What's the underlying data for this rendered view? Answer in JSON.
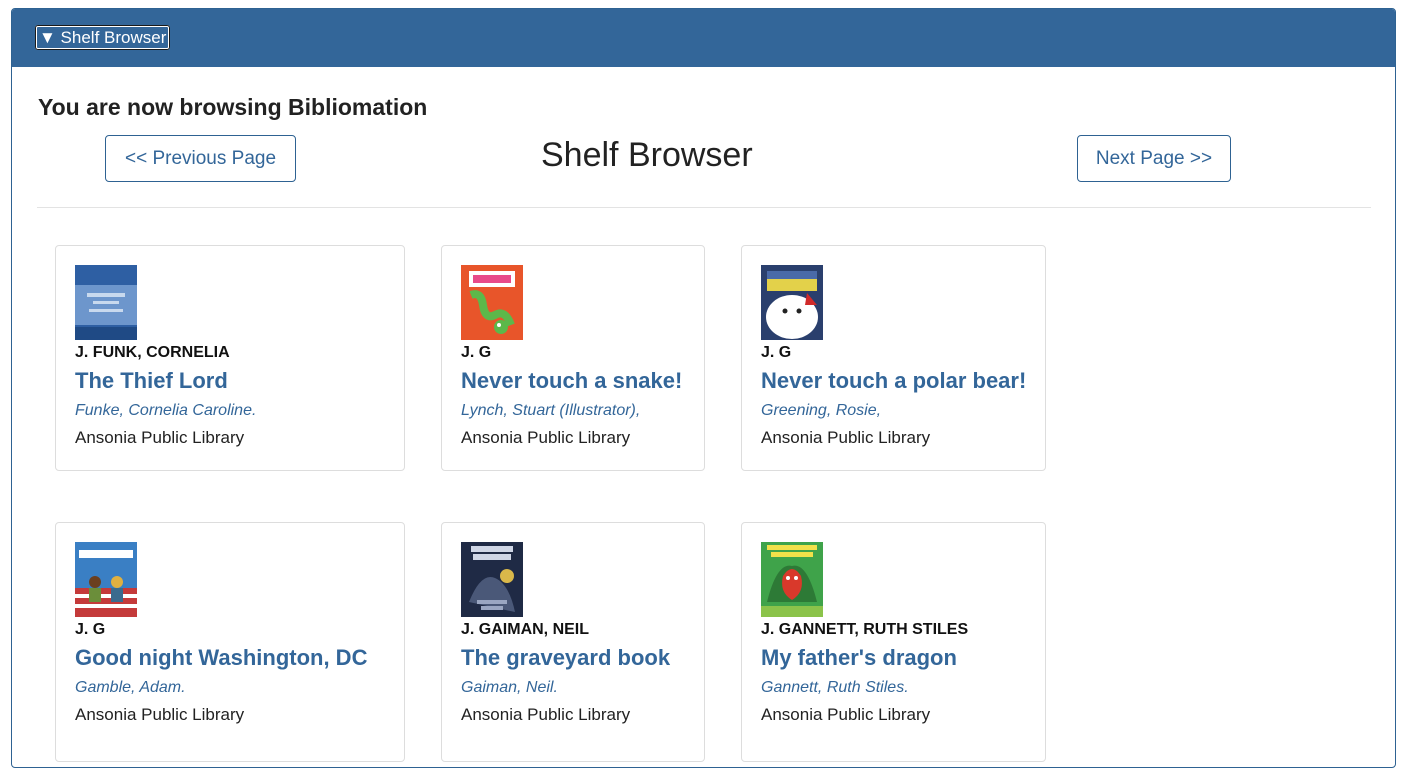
{
  "panel": {
    "toggle_label": "▼ Shelf Browser"
  },
  "header": {
    "browsing_text": "You are now browsing Bibliomation",
    "title": "Shelf Browser",
    "prev_label": "<< Previous Page",
    "next_label": "Next Page >>"
  },
  "books": [
    {
      "call_number": "J. FUNK, CORNELIA",
      "title": "The Thief Lord",
      "author": "Funke, Cornelia Caroline.",
      "library": "Ansonia Public Library",
      "cover_colors": [
        "#3d6fb0",
        "#9dbbe0"
      ]
    },
    {
      "call_number": "J. G",
      "title": "Never touch a snake!",
      "author": "Lynch, Stuart (Illustrator),",
      "library": "Ansonia Public Library",
      "cover_colors": [
        "#e8552a",
        "#5cb84a"
      ]
    },
    {
      "call_number": "J. G",
      "title": "Never touch a polar bear!",
      "author": "Greening, Rosie,",
      "library": "Ansonia Public Library",
      "cover_colors": [
        "#2a3f6d",
        "#ffffff"
      ]
    },
    {
      "call_number": "J. G",
      "title": "Good night Washington, DC",
      "author": "Gamble, Adam.",
      "library": "Ansonia Public Library",
      "cover_colors": [
        "#3a7fc4",
        "#c43a3a"
      ]
    },
    {
      "call_number": "J. GAIMAN, NEIL",
      "title": "The graveyard book",
      "author": "Gaiman, Neil.",
      "library": "Ansonia Public Library",
      "cover_colors": [
        "#1f2a45",
        "#6b7a9c"
      ]
    },
    {
      "call_number": "J. GANNETT, RUTH STILES",
      "title": "My father's dragon",
      "author": "Gannett, Ruth Stiles.",
      "library": "Ansonia Public Library",
      "cover_colors": [
        "#3fa34a",
        "#d9392b"
      ]
    }
  ]
}
